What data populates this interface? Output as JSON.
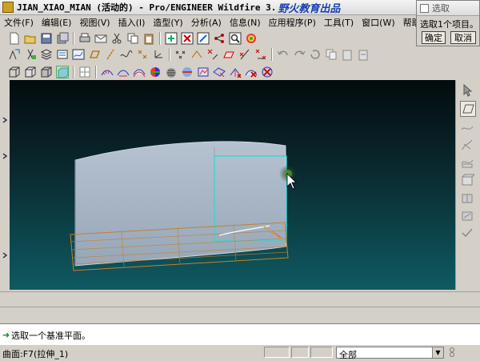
{
  "window": {
    "title": "JIAN_XIAO_MIAN (活动的) - Pro/ENGINEER Wildfire 3.",
    "watermark": "野火教育出品"
  },
  "menu": {
    "items": [
      "文件(F)",
      "编辑(E)",
      "视图(V)",
      "插入(I)",
      "造型(Y)",
      "分析(A)",
      "信息(N)",
      "应用程序(P)",
      "工具(T)",
      "窗口(W)",
      "帮助(H)"
    ]
  },
  "popup": {
    "title": "选取",
    "message": "选取1个项目。",
    "ok_label": "确定",
    "cancel_label": "取消"
  },
  "prompt": {
    "text": "选取一个基准平面。"
  },
  "status": {
    "selection": "曲面:F7(拉伸_1)",
    "filter_value": "全部"
  },
  "colors": {
    "viewport_top": "#030b0e",
    "viewport_bottom": "#0f5a62",
    "model_surface": "#a8b6c6",
    "highlight_cyan": "#33d6d6",
    "plane_orange": "#c0822a"
  },
  "toolbar": {
    "row1_icons": [
      "new-icon",
      "open-icon",
      "save-icon",
      "save-copy-icon",
      "print-icon",
      "cut-icon",
      "copy-icon",
      "paste-icon",
      "undo-icon",
      "redo-icon",
      "regenerate-icon",
      "find-icon",
      "info-icon"
    ],
    "row2_icons": [
      "sketch-icon",
      "datum-plane-icon",
      "datum-axis-icon",
      "datum-curve-icon",
      "datum-point-icon",
      "csys-icon",
      "extrude-icon",
      "revolve-icon",
      "sweep-icon",
      "blend-icon",
      "round-icon",
      "chamfer-icon",
      "hole-icon",
      "shell-icon",
      "rib-icon",
      "draft-icon",
      "mirror-icon",
      "pattern-icon"
    ],
    "row3_icons": [
      "view-named-icon",
      "shading-icon",
      "hidden-line-icon",
      "wireframe-icon",
      "repaint-icon",
      "refit-icon",
      "zoom-in-icon",
      "zoom-out-icon",
      "orient-icon",
      "saved-views-icon",
      "layers-icon",
      "appearance-icon"
    ]
  }
}
